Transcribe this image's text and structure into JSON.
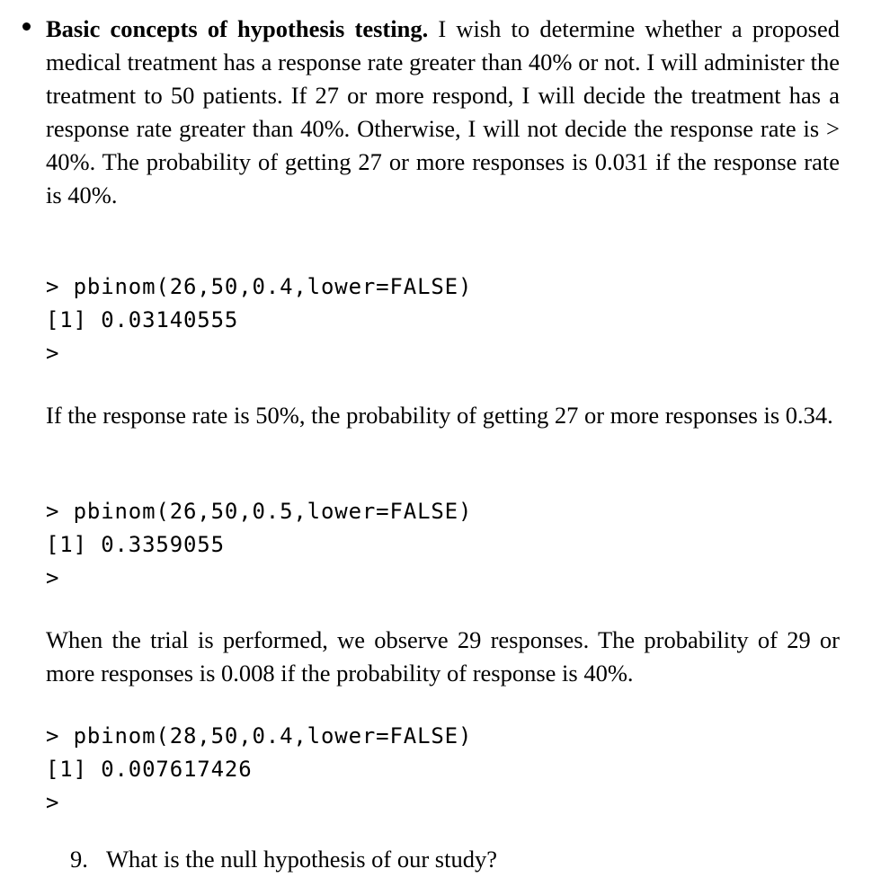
{
  "document": {
    "bullet_item": {
      "marker": "bullet-dot",
      "lead_bold": "Basic concepts of hypothesis testing.",
      "body": " I wish to determine whether a proposed medical treatment has a response rate greater than 40% or not. I will administer the treatment to 50 patients. If 27 or more respond, I will decide the treatment has a response rate greater than 40%. Otherwise, I will not decide the response rate is > 40%. The probability of getting 27 or more responses is 0.031 if the response rate is 40%."
    },
    "code_block_1": {
      "prompt_line": "> pbinom(26,50,0.4,lower=FALSE)",
      "result_line": "[1] 0.03140555",
      "trailing_prompt": ">"
    },
    "paragraph_2": "If the response rate is 50%, the probability of getting 27 or more responses is 0.34.",
    "code_block_2": {
      "prompt_line": "> pbinom(26,50,0.5,lower=FALSE)",
      "result_line": "[1] 0.3359055",
      "trailing_prompt": ">"
    },
    "paragraph_3": "When the trial is performed, we observe 29 responses. The probability of 29 or more responses is 0.008 if the probability of response is 40%.",
    "code_block_3": {
      "prompt_line": "> pbinom(28,50,0.4,lower=FALSE)",
      "result_line": "[1] 0.007617426",
      "trailing_prompt": ">"
    },
    "question": {
      "number": "9.",
      "text": "What is the null hypothesis of our study?"
    }
  },
  "colors": {
    "page_background": "#ffffff",
    "text": "#000000"
  }
}
